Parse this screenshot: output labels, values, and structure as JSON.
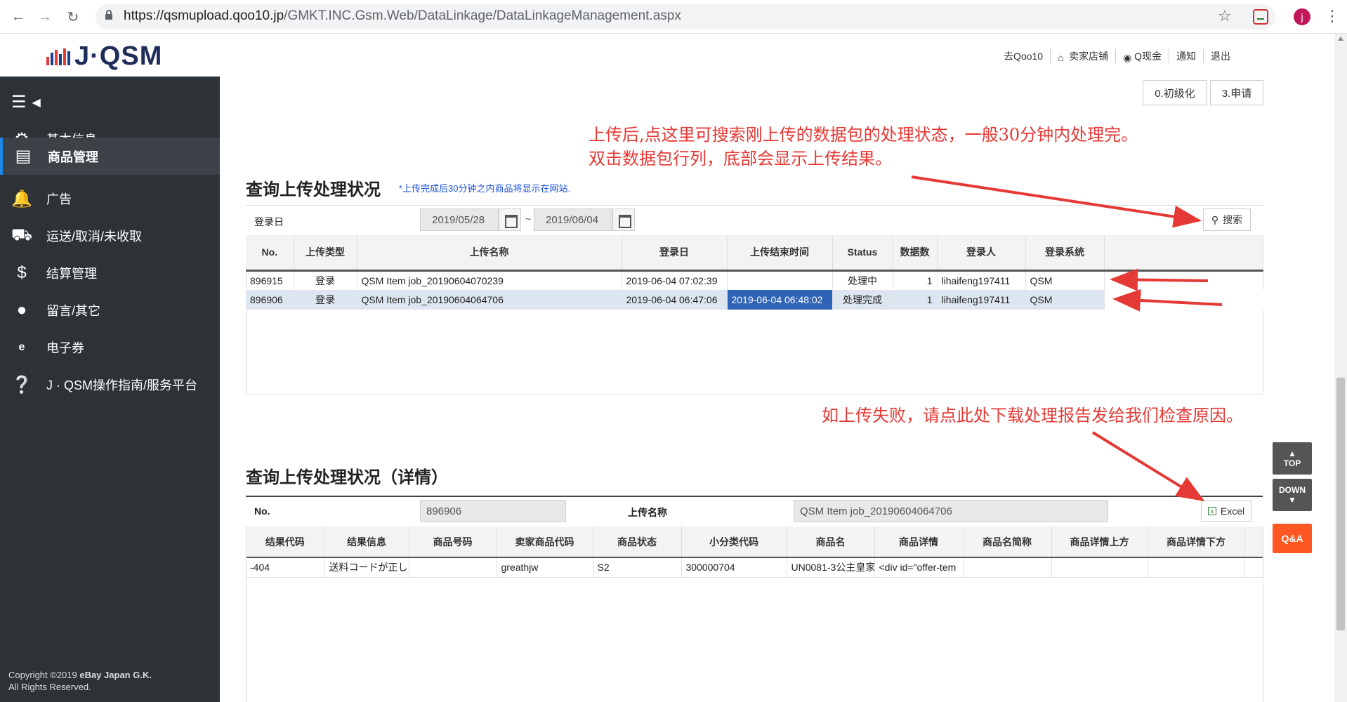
{
  "browser": {
    "url_host": "https://qsmupload.qoo10.jp",
    "url_path": "/GMKT.INC.Gsm.Web/DataLinkage/DataLinkageManagement.aspx",
    "profile_initial": "j"
  },
  "header": {
    "logo_text": "J·QSM",
    "links": [
      "去Qoo10",
      "卖家店铺",
      "Q现金",
      "通知",
      "退出"
    ]
  },
  "sidebar": {
    "items": [
      {
        "label": "基本信息",
        "icon": "gear-icon"
      },
      {
        "label": "商品管理",
        "icon": "document-icon",
        "active": true
      },
      {
        "label": "广告",
        "icon": "bell-icon"
      },
      {
        "label": "运送/取消/未收取",
        "icon": "truck-icon"
      },
      {
        "label": "结算管理",
        "icon": "money-bag-icon"
      },
      {
        "label": "留言/其它",
        "icon": "user-icon"
      },
      {
        "label": "电子券",
        "icon": "ticket-icon"
      },
      {
        "label": "J · QSM操作指南/服务平台",
        "icon": "help-icon"
      }
    ],
    "copyright_line1": "Copyright ©2019 ",
    "copyright_brand": "eBay Japan G.K.",
    "copyright_line2": "All Rights Reserved."
  },
  "toolbar": {
    "init_label": "0.初级化",
    "apply_label": "3.申请"
  },
  "annotations": {
    "top_line1": "上传后,点这里可搜索刚上传的数据包的处理状态，一般30分钟内处理完。",
    "top_line2": "双击数据包行列，底部会显示上传结果。",
    "bottom": "如上传失败，请点此处下载处理报告发给我们检查原因。"
  },
  "status_section": {
    "title": "查询上传处理状况",
    "note": "*上传完成后30分钟之内商品将显示在网站.",
    "date_label": "登录日",
    "date_from": "2019/05/28",
    "tilde": "~",
    "date_to": "2019/06/04",
    "search_label": "搜索",
    "columns": [
      "No.",
      "上传类型",
      "上传名称",
      "登录日",
      "上传结束时间",
      "Status",
      "数据数",
      "登录人",
      "登录系统"
    ],
    "rows": [
      {
        "no": "896915",
        "type": "登录",
        "name": "QSM Item job_20190604070239",
        "date": "2019-06-04 07:02:39",
        "end": "",
        "status": "处理中",
        "count": "1",
        "user": "lihaifeng197411",
        "system": "QSM"
      },
      {
        "no": "896906",
        "type": "登录",
        "name": "QSM Item job_20190604064706",
        "date": "2019-06-04 06:47:06",
        "end": "2019-06-04 06:48:02",
        "status": "处理完成",
        "count": "1",
        "user": "lihaifeng197411",
        "system": "QSM"
      }
    ]
  },
  "detail_section": {
    "title": "查询上传处理状况（详情）",
    "no_label": "No.",
    "no_value": "896906",
    "name_label": "上传名称",
    "name_value": "QSM Item job_20190604064706",
    "excel_label": "Excel",
    "columns": [
      "结果代码",
      "结果信息",
      "商品号码",
      "卖家商品代码",
      "商品状态",
      "小分类代码",
      "商品名",
      "商品详情",
      "商品名简称",
      "商品详情上方",
      "商品详情下方"
    ],
    "rows": [
      {
        "code": "-404",
        "msg": "送料コードが正し",
        "item_no": "",
        "seller_code": "greathjw",
        "state": "S2",
        "cat_code": "300000704",
        "item_name": "UN0081-3公主皇家",
        "detail": "<div id=\"offer-tem",
        "short_name": "",
        "detail_top": "",
        "detail_bottom": ""
      }
    ]
  },
  "float_buttons": {
    "top": "TOP",
    "down": "DOWN",
    "qa": "Q&A"
  }
}
